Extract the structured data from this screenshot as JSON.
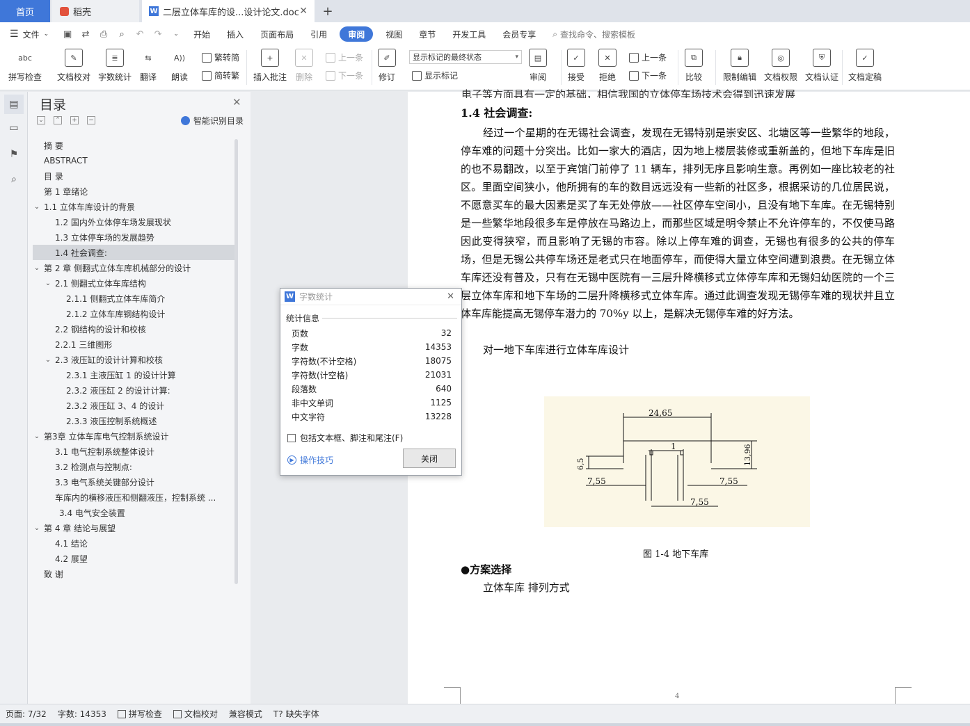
{
  "tabs": {
    "home": "首页",
    "daoke": "稻壳",
    "doc": "二层立体车库的设...设计论文.doc",
    "new": "+"
  },
  "ribbon": {
    "file": "文件",
    "tabs": [
      "开始",
      "插入",
      "页面布局",
      "引用",
      "审阅",
      "视图",
      "章节",
      "开发工具",
      "会员专享"
    ],
    "active": "审阅",
    "search": "查找命令、搜索模板"
  },
  "toolbar": {
    "spell_check": "拼写检查",
    "doc_proof": "文档校对",
    "word_count": "字数统计",
    "translate": "翻译",
    "read_aloud": "朗读",
    "trad_to_simp": "繁转简",
    "simp_to_trad": "简转繁",
    "insert_comment": "插入批注",
    "delete": "删除",
    "prev_comment": "上一条",
    "next_comment": "下一条",
    "track_changes": "修订",
    "markup_state": "显示标记的最终状态",
    "show_markup": "显示标记",
    "review": "审阅",
    "accept": "接受",
    "reject": "拒绝",
    "prev_change": "上一条",
    "next_change": "下一条",
    "compare": "比较",
    "restrict_edit": "限制编辑",
    "doc_permission": "文档权限",
    "doc_auth": "文档认证",
    "doc_finalize": "文档定稿"
  },
  "toc": {
    "title": "目录",
    "smart": "智能识别目录",
    "items": [
      {
        "label": "摘  要",
        "level": 0,
        "caret": ""
      },
      {
        "label": "ABSTRACT",
        "level": 0,
        "caret": ""
      },
      {
        "label": "目  录",
        "level": 0,
        "caret": ""
      },
      {
        "label": "第 1 章绪论",
        "level": 0,
        "caret": ""
      },
      {
        "label": "1.1  立体车库设计的背景",
        "level": 0,
        "caret": "⌄"
      },
      {
        "label": "1.2  国内外立体停车场发展现状",
        "level": 1,
        "caret": ""
      },
      {
        "label": "1.3  立体停车场的发展趋势",
        "level": 1,
        "caret": ""
      },
      {
        "label": "1.4  社会调查:",
        "level": 1,
        "caret": "",
        "selected": true
      },
      {
        "label": "第 2 章  侧翻式立体车库机械部分的设计",
        "level": 0,
        "caret": "⌄"
      },
      {
        "label": "2.1  侧翻式立体车库结构",
        "level": 1,
        "caret": "⌄"
      },
      {
        "label": "2.1.1  侧翻式立体车库简介",
        "level": 2,
        "caret": ""
      },
      {
        "label": "2.1.2    立体车库钢结构设计",
        "level": 2,
        "caret": ""
      },
      {
        "label": "2.2  钢结构的设计和校核",
        "level": 1,
        "caret": ""
      },
      {
        "label": "2.2.1  三维图形",
        "level": 1,
        "caret": ""
      },
      {
        "label": "2.3  液压缸的设计计算和校核",
        "level": 1,
        "caret": "⌄"
      },
      {
        "label": "2.3.1 主液压缸 1 的设计计算",
        "level": 2,
        "caret": ""
      },
      {
        "label": "2.3.2 液压缸 2 的设计计算:",
        "level": 2,
        "caret": ""
      },
      {
        "label": "2.3.2  液压缸 3、4 的设计",
        "level": 2,
        "caret": ""
      },
      {
        "label": "2.3.3  液压控制系统概述",
        "level": 2,
        "caret": ""
      },
      {
        "label": "第3章  立体车库电气控制系统设计",
        "level": 0,
        "caret": "⌄"
      },
      {
        "label": "3.1  电气控制系统整体设计",
        "level": 1,
        "caret": ""
      },
      {
        "label": "3.2  检测点与控制点:",
        "level": 1,
        "caret": ""
      },
      {
        "label": "3.3  电气系统关键部分设计",
        "level": 1,
        "caret": ""
      },
      {
        "label": "车库内的横移液压和侧翻液压，控制系统 ...",
        "level": 1,
        "caret": ""
      },
      {
        "label": "3.4  电气安全装置",
        "level": 1,
        "caret": "",
        "extra": 6
      },
      {
        "label": "第 4 章  结论与展望",
        "level": 0,
        "caret": "⌄"
      },
      {
        "label": "4.1    结论",
        "level": 1,
        "caret": ""
      },
      {
        "label": "4.2    展望",
        "level": 1,
        "caret": ""
      },
      {
        "label": "致    谢",
        "level": 0,
        "caret": ""
      }
    ]
  },
  "doc": {
    "prev_line": "电子等方面具有一定的基础，相信我国的立体停车场技术会得到迅速发展",
    "heading": "1.4  社会调查:",
    "para1": "经过一个星期的在无锡社会调查，发现在无锡特别是崇安区、北塘区等一些繁华的地段，停车难的问题十分突出。比如一家大的酒店，因为地上楼层装修或重新盖的，但地下车库是旧的也不易翻改，以至于宾馆门前停了 11 辆车，排列无序且影响生意。再例如一座比较老的社区。里面空间狭小，他所拥有的车的数目远远没有一些新的社区多，根据采访的几位居民说，不愿意买车的最大因素是买了车无处停放——社区停车空间小，且没有地下车库。在无锡特别是一些繁华地段很多车是停放在马路边上，而那些区域是明令禁止不允许停车的，不仅使马路因此变得狭窄，而且影响了无锡的市容。除以上停车难的调查，无锡也有很多的公共的停车场，但是无锡公共停车场还是老式只在地面停车，而使得大量立体空间遭到浪费。在无锡立体车库还没有普及，只有在无锡中医院有一三层升降横移式立体停车库和无锡妇幼医院的一个三层立体车库和地下车场的二层升降横移式立体车库。通过此调查发现无锡停车难的现状并且立体车库能提高无锡停车潜力的 70%y 以上，是解决无锡停车难的好方法。",
    "para2": "对一地下车库进行立体车库设计",
    "figure_labels": {
      "top": "24,65",
      "one": "1",
      "left_v": "6,5",
      "right_v": "13,96",
      "bl": "7,55",
      "br": "7,55",
      "bm": "7,55"
    },
    "caption": "图 1-4  地下车库",
    "scheme": "●方案选择",
    "scheme_sub": "立体车库  排列方式",
    "page_number": "4"
  },
  "dialog": {
    "title": "字数统计",
    "section": "统计信息",
    "rows": [
      {
        "label": "页数",
        "value": "32"
      },
      {
        "label": "字数",
        "value": "14353"
      },
      {
        "label": "字符数(不计空格)",
        "value": "18075"
      },
      {
        "label": "字符数(计空格)",
        "value": "21031"
      },
      {
        "label": "段落数",
        "value": "640"
      },
      {
        "label": "非中文单词",
        "value": "1125"
      },
      {
        "label": "中文字符",
        "value": "13228"
      }
    ],
    "checkbox": "包括文本框、脚注和尾注(F)",
    "tips": "操作技巧",
    "close": "关闭"
  },
  "status": {
    "page": "页面: 7/32",
    "words": "字数: 14353",
    "spell": "拼写检查",
    "proof": "文档校对",
    "compat": "兼容模式",
    "missing_font": "缺失字体"
  },
  "colors": {
    "accent": "#3f77d9",
    "selected_toc": "#d4d7dc",
    "figure_bg": "#fbf7e6"
  }
}
